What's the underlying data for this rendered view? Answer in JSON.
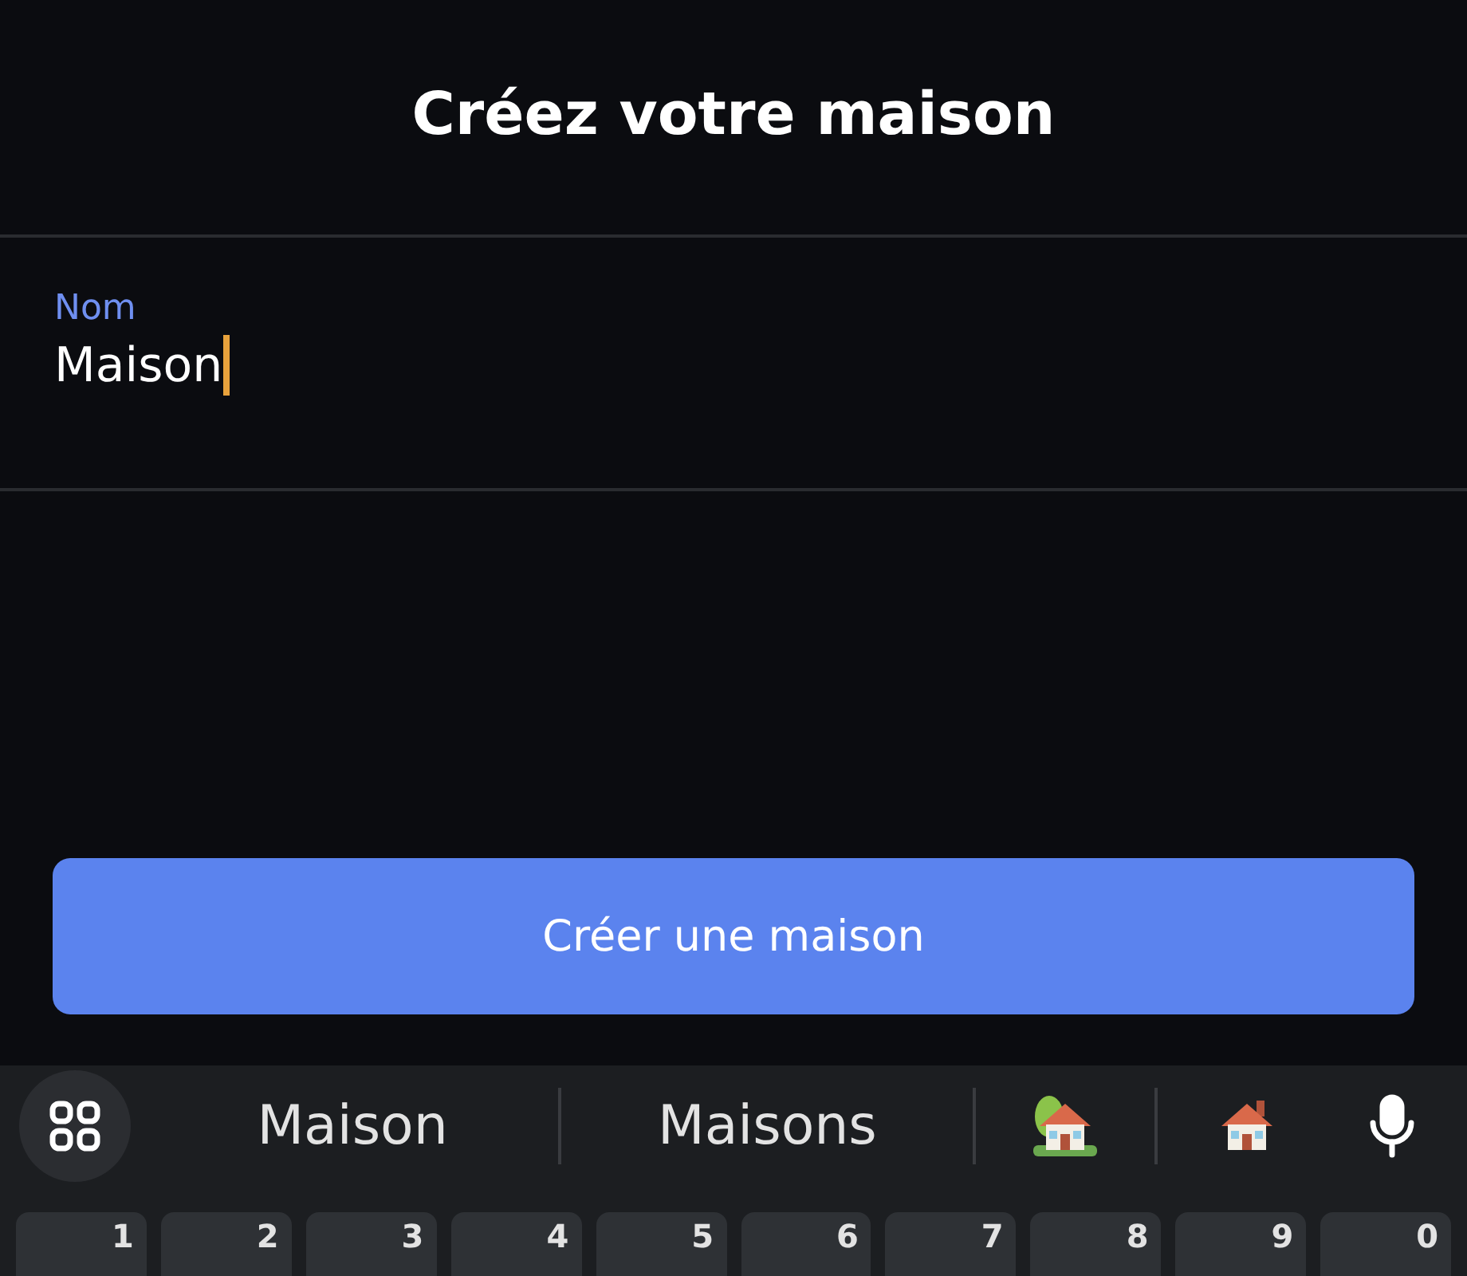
{
  "header": {
    "title": "Créez votre maison"
  },
  "name_field": {
    "label": "Nom",
    "value": "Maison",
    "focused": true
  },
  "create_button": {
    "label": "Créer une maison"
  },
  "keyboard": {
    "suggestions": [
      {
        "kind": "text",
        "label": "Maison"
      },
      {
        "kind": "text",
        "label": "Maisons"
      },
      {
        "kind": "house-tree"
      },
      {
        "kind": "house"
      }
    ],
    "number_keys": [
      "1",
      "2",
      "3",
      "4",
      "5",
      "6",
      "7",
      "8",
      "9",
      "0"
    ]
  }
}
